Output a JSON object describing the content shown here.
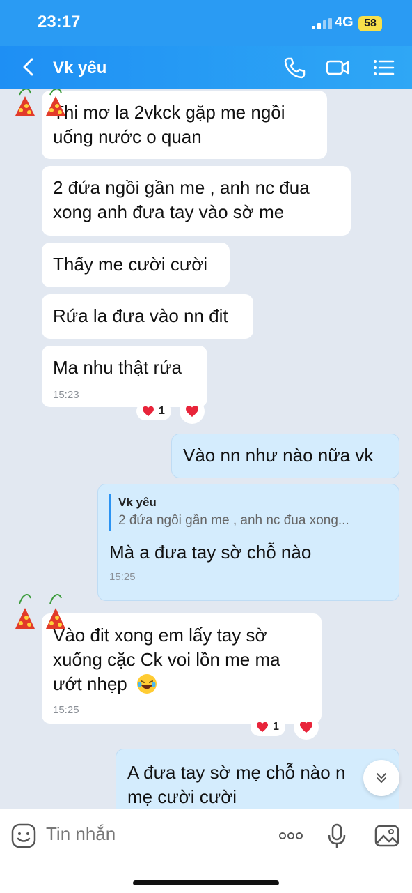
{
  "status": {
    "time": "23:17",
    "network": "4G",
    "battery": "58"
  },
  "header": {
    "title": "Vk yêu"
  },
  "messages": {
    "m1": {
      "line1": "Thi mơ la 2vkck gặp me ngồi",
      "line2": "uống nước o quan"
    },
    "m2": {
      "line1": "2 đứa ngồi gần me , anh nc đua",
      "line2": "xong anh đưa tay vào sờ me"
    },
    "m3": {
      "text": "Thấy me cười cười"
    },
    "m4": {
      "text": "Rứa la đưa vào nn đit"
    },
    "m5": {
      "text": "Ma nhu thật rứa",
      "time": "15:23",
      "reaction_count": "1"
    },
    "m6": {
      "text": "Vào nn như nào nữa vk"
    },
    "m7": {
      "quote_name": "Vk yêu",
      "quote_text": "2 đứa ngồi gần me , anh nc đua xong...",
      "text": "Mà a đưa tay sờ chỗ nào",
      "time": "15:25"
    },
    "m8": {
      "line1": "Vào đit xong em lấy tay sờ",
      "line2": "xuống cặc Ck voi lồn me ma",
      "line3": "ướt nhẹp",
      "time": "15:25",
      "reaction_count": "1"
    },
    "m9": {
      "line1": "A đưa tay sờ mẹ chỗ nào n",
      "line2": "mẹ cười cười"
    }
  },
  "composer": {
    "placeholder": "Tin nhắn"
  },
  "icons": [
    "back-icon",
    "phone-icon",
    "video-icon",
    "menu-icon",
    "heart-icon",
    "chevron-down-icon",
    "sticker-icon",
    "more-icon",
    "mic-icon",
    "image-icon",
    "laughing-emoji-icon"
  ],
  "colors": {
    "header": "#2a9bf3",
    "chat_bg": "#e2e8f1",
    "incoming": "#ffffff",
    "outgoing": "#d4ecfd",
    "reaction": "#e8243a"
  }
}
